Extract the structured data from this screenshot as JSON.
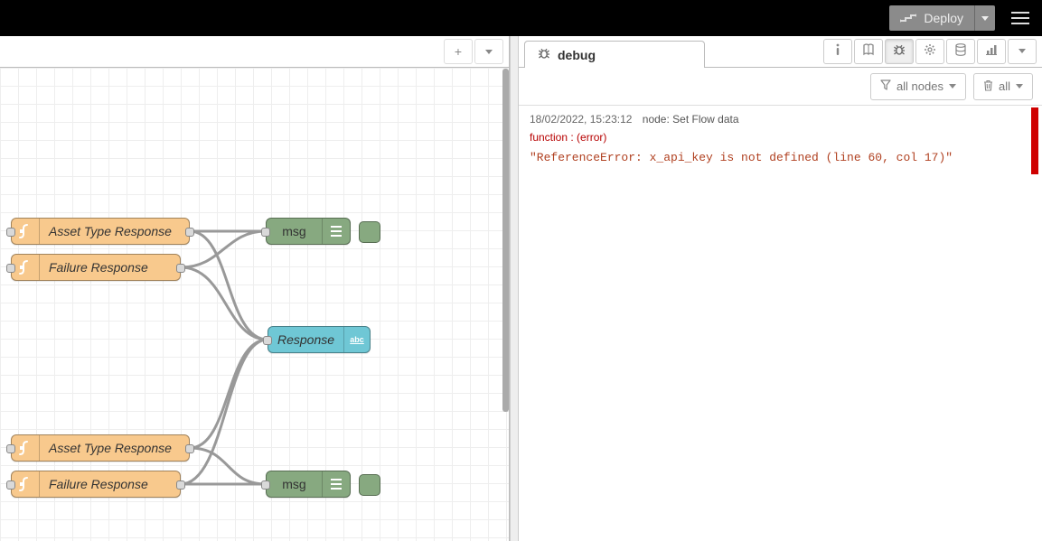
{
  "header": {
    "deploy_label": "Deploy"
  },
  "workspace": {
    "tabs": {
      "add_title": "+",
      "menu_title": "▾"
    }
  },
  "nodes": {
    "asset1": {
      "label": "Asset Type Response"
    },
    "failure1": {
      "label": "Failure Response"
    },
    "debug1": {
      "label": "msg"
    },
    "resp1": {
      "label": "Response"
    },
    "asset2": {
      "label": "Asset Type Response"
    },
    "failure2": {
      "label": "Failure Response"
    },
    "debug2": {
      "label": "msg"
    }
  },
  "sidebar": {
    "tab_label": "debug",
    "filter_label": "all nodes",
    "clear_label": "all"
  },
  "messages": [
    {
      "timestamp": "18/02/2022, 15:23:12",
      "node_label": "node: Set Flow data",
      "source": "function : (error)",
      "payload": "\"ReferenceError: x_api_key is not defined (line 60, col 17)\""
    }
  ]
}
